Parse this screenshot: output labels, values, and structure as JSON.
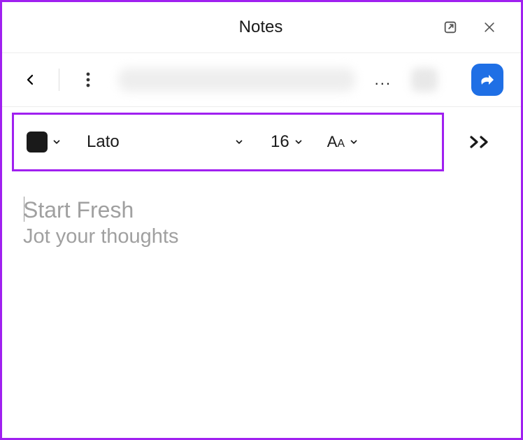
{
  "header": {
    "title": "Notes"
  },
  "nav": {
    "ellipsis": "..."
  },
  "toolbar": {
    "font_name": "Lato",
    "font_size": "16"
  },
  "editor": {
    "placeholder_title": "Start Fresh",
    "placeholder_sub": "Jot your thoughts"
  }
}
